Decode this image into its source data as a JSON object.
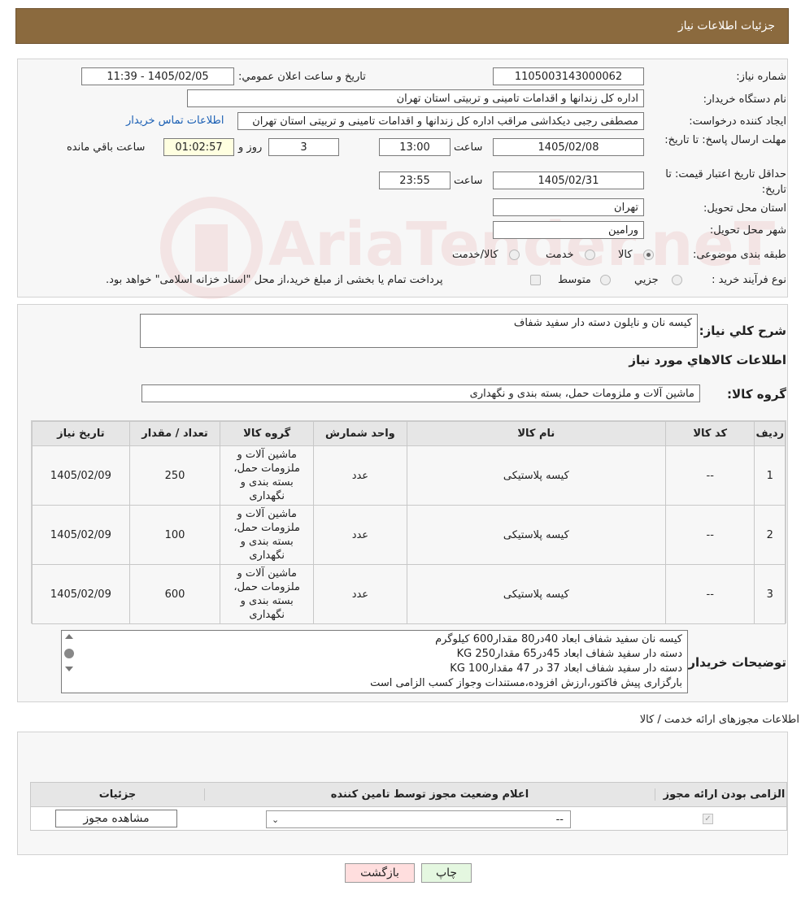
{
  "header": {
    "title": "جزئیات اطلاعات نیاز"
  },
  "watermark": "AriaTender.neT",
  "form": {
    "need_number_label": "شماره نیاز:",
    "need_number": "1105003143000062",
    "announce_label": "تاريخ و ساعت اعلان عمومي:",
    "announce_value": "1405/02/05 - 11:39",
    "buyer_label": "نام دستگاه خريدار:",
    "buyer_value": "اداره کل زندانها و اقدامات تامینی و تربیتی استان تهران",
    "creator_label": "ايجاد کننده درخواست:",
    "creator_value": "مصطفی رجبی دیکداشی مراقب  اداره کل زندانها و اقدامات تامینی و تربیتی استان تهران",
    "contact_link": "اطلاعات تماس خريدار",
    "deadline_label": "مهلت ارسال پاسخ: تا تاريخ:",
    "deadline_date": "1405/02/08",
    "time_label": "ساعت",
    "deadline_time": "13:00",
    "days_value": "3",
    "days_label": "روز و",
    "remaining_time": "01:02:57",
    "remaining_label": "ساعت باقي مانده",
    "validity_label": "حداقل تاريخ اعتبار قيمت: تا تاريخ:",
    "validity_date": "1405/02/31",
    "validity_time": "23:55",
    "province_label": "استان محل تحويل:",
    "province_value": "تهران",
    "city_label": "شهر محل تحويل:",
    "city_value": "ورامين",
    "category_label": "طبقه بندی موضوعی:",
    "category_options": [
      "کالا",
      "خدمت",
      "کالا/خدمت"
    ],
    "process_label": "نوع فرآيند خريد :",
    "process_options": [
      "جزيي",
      "متوسط"
    ],
    "process_note": "پرداخت تمام يا بخشی از مبلغ خريد،از محل \"اسناد خزانه اسلامی\" خواهد بود."
  },
  "description": {
    "label": "شرح کلي نياز:",
    "value": "کیسه نان و نایلون دسته دار سفید شفاف"
  },
  "goods_section": {
    "title": "اطلاعات کالاهاي مورد نياز",
    "group_label": "گروه کالا:",
    "group_value": "ماشین آلات و ملزومات حمل، بسته بندی و نگهداری"
  },
  "items_table": {
    "headers": [
      "رديف",
      "کد کالا",
      "نام کالا",
      "واحد شمارش",
      "گروه کالا",
      "تعداد / مقدار",
      "تاريخ نياز"
    ],
    "rows": [
      {
        "row": "1",
        "code": "--",
        "name": "کیسه پلاستیکی",
        "unit": "عدد",
        "group": "ماشین آلات و ملزومات حمل، بسته بندی و نگهداری",
        "qty": "250",
        "date": "1405/02/09"
      },
      {
        "row": "2",
        "code": "--",
        "name": "کیسه پلاستیکی",
        "unit": "عدد",
        "group": "ماشین آلات و ملزومات حمل، بسته بندی و نگهداری",
        "qty": "100",
        "date": "1405/02/09"
      },
      {
        "row": "3",
        "code": "--",
        "name": "کیسه پلاستیکی",
        "unit": "عدد",
        "group": "ماشین آلات و ملزومات حمل، بسته بندی و نگهداری",
        "qty": "600",
        "date": "1405/02/09"
      }
    ]
  },
  "buyer_notes": {
    "label": "توضيحات خريدار:",
    "lines": [
      "کیسه نان سفید شفاف ابعاد 40در80 مقدار600 کیلوگرم",
      "دسته دار سفید شفاف ابعاد 45در65 مقدار250 KG",
      "دسته دار سفید شفاف ابعاد 37 در 47 مقدار100 KG",
      "بارگزاری پیش فاکتور،ارزش افزوده،مستندات وجواز کسب الزامی است"
    ]
  },
  "permits": {
    "title": "اطلاعات مجوزهای ارائه خدمت / کالا",
    "headers": [
      "الزامی بودن ارائه مجوز",
      "اعلام وضعیت مجوز توسط تامین کننده",
      "جزئیات"
    ],
    "select_value": "--",
    "view_button": "مشاهده مجوز"
  },
  "footer": {
    "print": "چاپ",
    "back": "بازگشت"
  }
}
